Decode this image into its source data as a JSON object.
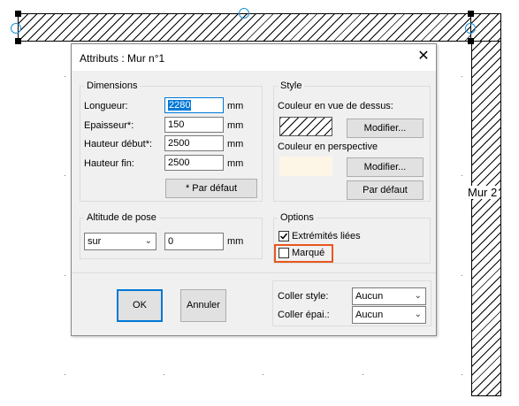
{
  "canvas": {
    "wall_label": "Mur 2"
  },
  "dialog": {
    "title": "Attributs : Mur n°1",
    "close_glyph": "✕",
    "dimensions": {
      "group_label": "Dimensions",
      "unit": "mm",
      "longueur_label": "Longueur:",
      "longueur_value": "2280",
      "epaisseur_label": "Epaisseur*:",
      "epaisseur_value": "150",
      "hauteur_debut_label": "Hauteur début*:",
      "hauteur_debut_value": "2500",
      "hauteur_fin_label": "Hauteur fin:",
      "hauteur_fin_value": "2500",
      "default_button": "* Par défaut"
    },
    "style": {
      "group_label": "Style",
      "top_color_label": "Couleur en vue de dessus:",
      "perspective_color_label": "Couleur en perspective",
      "perspective_swatch_color": "#fdf6e6",
      "modify_button": "Modifier...",
      "default_button": "Par défaut"
    },
    "altitude": {
      "group_label": "Altitude de pose",
      "select_value": "sur",
      "input_value": "0",
      "unit": "mm"
    },
    "options": {
      "group_label": "Options",
      "linked_ends_label": "Extrémités liées",
      "linked_ends_checked": true,
      "marked_label": "Marqué",
      "marked_checked": false,
      "highlight_color": "#e8571f"
    },
    "footer": {
      "ok_label": "OK",
      "cancel_label": "Annuler",
      "paste_style_label": "Coller style:",
      "paste_style_value": "Aucun",
      "paste_thickness_label": "Coller épai.:",
      "paste_thickness_value": "Aucun"
    }
  }
}
